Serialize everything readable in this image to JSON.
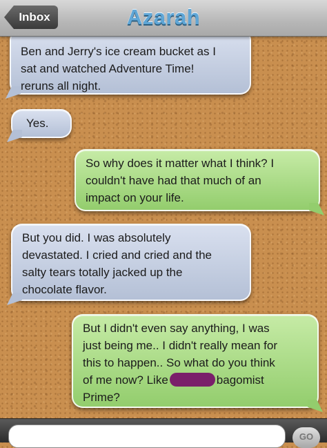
{
  "header": {
    "back_label": "Inbox",
    "title": "Azarah"
  },
  "messages": [
    {
      "side": "left",
      "lines": [
        "Ben and Jerry's ice cream bucket as I",
        "sat and watched Adventure Time!",
        "reruns all night."
      ]
    },
    {
      "side": "left",
      "lines": [
        "Yes."
      ]
    },
    {
      "side": "right",
      "lines": [
        "So why does it matter what I think? I",
        "couldn't have had that much of an",
        "impact on your life."
      ]
    },
    {
      "side": "left",
      "lines": [
        "But you did. I was absolutely",
        "devastated. I cried and cried and the",
        "salty tears totally jacked up the",
        "chocolate flavor."
      ]
    },
    {
      "side": "right",
      "lines": [
        "But I didn't even say anything, I was",
        "just being me.. I didn't really mean for",
        "this to happen.. So what do you think"
      ],
      "line4_a": "of me now? Like",
      "line4_b": "bagomist",
      "line5": "Prime?"
    }
  ],
  "input": {
    "go_label": "GO"
  },
  "colors": {
    "incoming": "#b4c0d6",
    "outgoing": "#93cd6d",
    "title": "#5fa6d6"
  }
}
